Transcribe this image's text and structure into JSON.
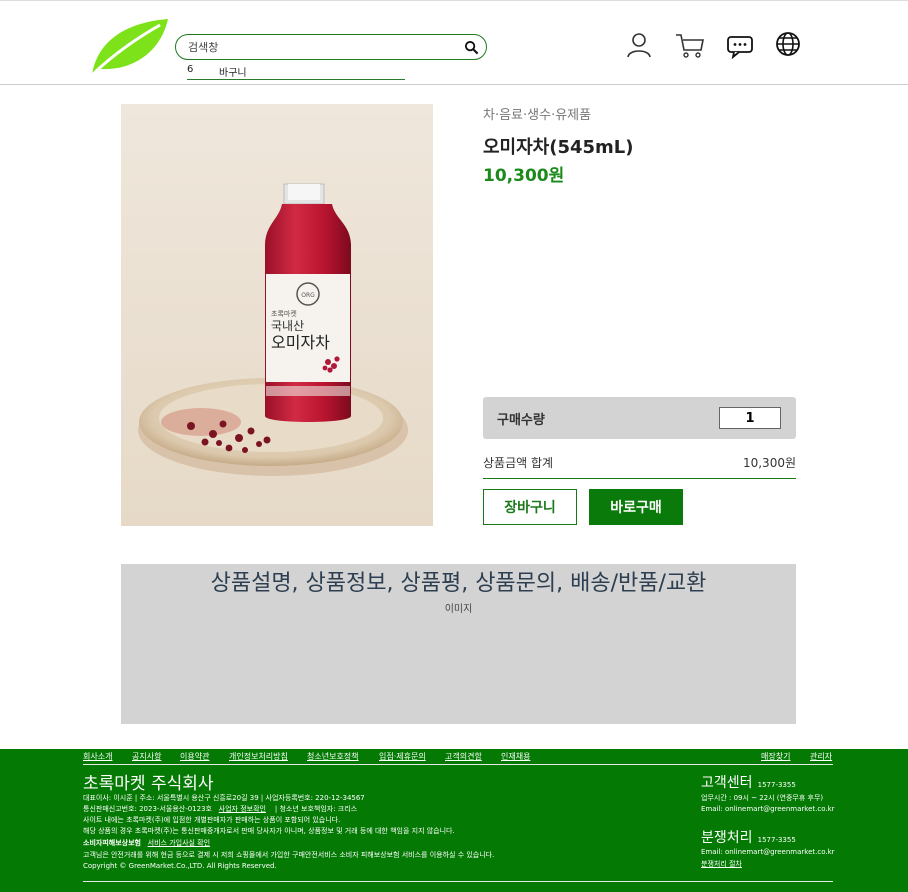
{
  "search": {
    "placeholder": "검색창"
  },
  "recent_search": {
    "number": "6",
    "keyword": "바구니"
  },
  "header_icons": [
    "user-icon",
    "cart-icon",
    "chat-icon",
    "globe-icon"
  ],
  "product": {
    "category": "차·음료·생수·유제품",
    "name": "오미자차(545mL)",
    "price": "10,300원",
    "quantity_label": "구매수량",
    "quantity": "1",
    "total_label": "상품금액 합계",
    "total": "10,300원",
    "cart_button": "장바구니",
    "buy_button": "바로구매",
    "image_text": {
      "brand": "초록마켓",
      "line1": "국내산",
      "line2": "오미자차"
    }
  },
  "detail": {
    "tabs": "상품설명, 상품정보, 상품평, 상품문의, 배송/반품/교환",
    "image_label": "이미지"
  },
  "footer": {
    "nav_left": [
      "회사소개",
      "공지사항",
      "이용약관",
      "개인정보처리방침",
      "청소년보호정책",
      "입점·제휴문의",
      "고객의견함",
      "인재채용"
    ],
    "nav_right": [
      "매장찾기",
      "관리자"
    ],
    "company": "초록마켓 주식회사",
    "info1": "대표이사: 이시훈   |   주소: 서울특별시 용산구 신흥로20길 39   |   사업자등록번호: 220-12-34567",
    "info2_a": "통신판매신고번호: 2023-서울용산-0123호",
    "info2_link": "사업자 정보확인",
    "info2_b": "|   청소년 보호책임자: 크리스",
    "info3": "사이트 내에는 초록마켓(주)에 입점한 개별판매자가 판매하는 상품이 포함되어 있습니다.",
    "info4": "해당 상품의 경우 초록마켓(주)는 통신판매중개자로서 판매 당사자가 아니며, 상품정보 및 거래 등에 대한 책임을 지지 않습니다.",
    "info5_a": "소비자피해보상보험",
    "info5_link": "서비스 가입사실 확인",
    "info6": "고객님은 안전거래를 위해 현금 등으로 결제 시 저희 쇼핑몰에서 가입한 구매안전서비스 소비자 피해보상보험 서비스를 이용하실 수 있습니다.",
    "copyright": "Copyright © GreenMarket.Co.,LTD. All Rights Reserved.",
    "cs_title": "고객센터",
    "cs_tel": "1577-3355",
    "cs_hours": "업무시간 : 09시 ~ 22시 (연중무휴 후무)",
    "cs_email": "Email: onlinemart@greenmarket.co.kr",
    "dispute_title": "분쟁처리",
    "dispute_tel": "1577-3355",
    "dispute_email": "Email: onlinemart@greenmarket.co.kr",
    "dispute_link": "분쟁처리 절차"
  },
  "colors": {
    "brand_green": "#047a04",
    "price_green": "#1a8a1a",
    "panel_gray": "#d3d3d3"
  }
}
